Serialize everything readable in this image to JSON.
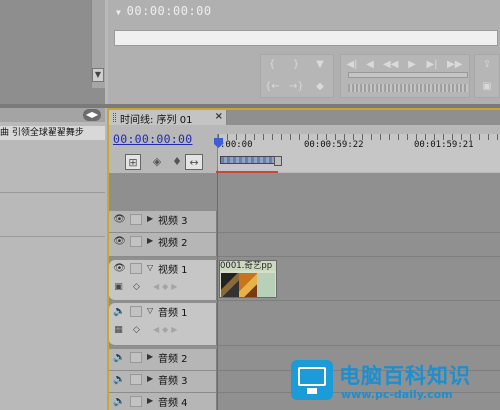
{
  "source_monitor": {
    "timecode": "00:00:00:00"
  },
  "project_panel": {
    "menu_icon": "panel-menu-icon",
    "item_label": "曲 引领全球翟翟舞步"
  },
  "timeline": {
    "tab_title": "时间线: 序列 01",
    "close_label": "×",
    "timecode": "00:00:00:00",
    "ruler": {
      "labels": [
        ":00:00",
        "00:00:59:22",
        "00:01:59:21"
      ]
    },
    "tracks": [
      {
        "name": "视频 3",
        "kind": "video",
        "expanded": false
      },
      {
        "name": "视频 2",
        "kind": "video",
        "expanded": false
      },
      {
        "name": "视频 1",
        "kind": "video",
        "expanded": true
      },
      {
        "name": "音频 1",
        "kind": "audio",
        "expanded": true
      },
      {
        "name": "音频 2",
        "kind": "audio",
        "expanded": false
      },
      {
        "name": "音频 3",
        "kind": "audio",
        "expanded": false
      },
      {
        "name": "音频 4",
        "kind": "audio",
        "expanded": false
      }
    ],
    "clip": {
      "label": "0001.奇艺pp"
    }
  },
  "watermark": {
    "name": "电脑百科知识",
    "url": "www.pc-daily.com",
    "accent": "#1b8fd0"
  }
}
